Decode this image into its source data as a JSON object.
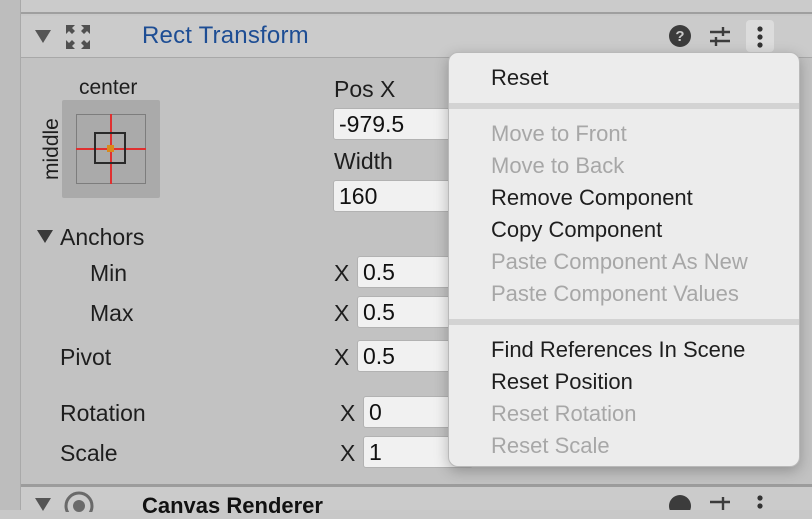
{
  "header": {
    "title": "Rect Transform",
    "fold_icon": "triangle-down-icon",
    "move_icon": "move-arrows-icon",
    "help_icon": "help-icon",
    "presets_icon": "sliders-icon",
    "more_icon": "more-vertical-icon"
  },
  "anchor_preset": {
    "horizontal_label": "center",
    "vertical_label": "middle"
  },
  "fields": {
    "pos_x_label": "Pos X",
    "pos_x_value": "-979.5",
    "width_label": "Width",
    "width_value": "160"
  },
  "anchors": {
    "label": "Anchors",
    "min_label": "Min",
    "min_axis": "X",
    "min_x_value": "0.5",
    "max_label": "Max",
    "max_axis": "X",
    "max_x_value": "0.5"
  },
  "pivot": {
    "label": "Pivot",
    "axis": "X",
    "x_value": "0.5"
  },
  "rotation": {
    "label": "Rotation",
    "axis": "X",
    "x_value": "0"
  },
  "scale": {
    "label": "Scale",
    "axis": "X",
    "x_value": "1"
  },
  "context_menu": {
    "items": [
      {
        "label": "Reset",
        "enabled": true
      },
      {
        "label": "Move to Front",
        "enabled": false
      },
      {
        "label": "Move to Back",
        "enabled": false
      },
      {
        "label": "Remove Component",
        "enabled": true
      },
      {
        "label": "Copy Component",
        "enabled": true
      },
      {
        "label": "Paste Component As New",
        "enabled": false
      },
      {
        "label": "Paste Component Values",
        "enabled": false
      },
      {
        "label": "Find References In Scene",
        "enabled": true
      },
      {
        "label": "Reset Position",
        "enabled": true
      },
      {
        "label": "Reset Rotation",
        "enabled": false
      },
      {
        "label": "Reset Scale",
        "enabled": false
      }
    ]
  },
  "footer": {
    "title": "Canvas Renderer"
  },
  "colors": {
    "title_blue": "#1d4d94",
    "anchor_red": "#e03030",
    "pivot_orange": "#d98a1c"
  }
}
